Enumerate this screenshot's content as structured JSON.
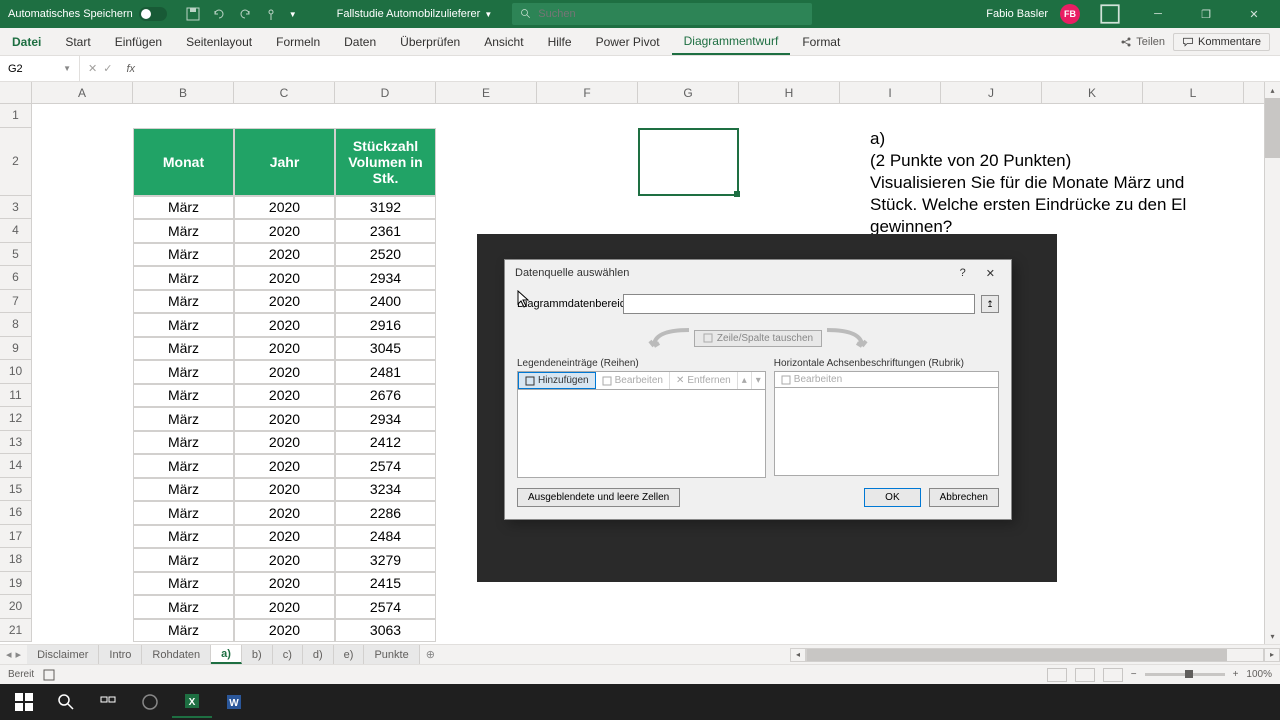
{
  "titlebar": {
    "autosave": "Automatisches Speichern",
    "filename": "Fallstudie Automobilzulieferer",
    "search_placeholder": "Suchen",
    "user_name": "Fabio Basler",
    "user_initials": "FB"
  },
  "ribbon": {
    "tabs": [
      "Datei",
      "Start",
      "Einfügen",
      "Seitenlayout",
      "Formeln",
      "Daten",
      "Überprüfen",
      "Ansicht",
      "Hilfe",
      "Power Pivot",
      "Diagrammentwurf",
      "Format"
    ],
    "active_tab": "Diagrammentwurf",
    "share": "Teilen",
    "comments": "Kommentare"
  },
  "formula_bar": {
    "name_box": "G2",
    "formula": ""
  },
  "columns": [
    "A",
    "B",
    "C",
    "D",
    "E",
    "F",
    "G",
    "H",
    "I",
    "J",
    "K",
    "L"
  ],
  "rows": [
    1,
    2,
    3,
    4,
    5,
    6,
    7,
    8,
    9,
    10,
    11,
    12,
    13,
    14,
    15,
    16,
    17,
    18,
    19,
    20,
    21
  ],
  "table": {
    "headers": [
      "Monat",
      "Jahr",
      "Stückzahl Volumen in Stk."
    ],
    "data": [
      [
        "März",
        "2020",
        "3192"
      ],
      [
        "März",
        "2020",
        "2361"
      ],
      [
        "März",
        "2020",
        "2520"
      ],
      [
        "März",
        "2020",
        "2934"
      ],
      [
        "März",
        "2020",
        "2400"
      ],
      [
        "März",
        "2020",
        "2916"
      ],
      [
        "März",
        "2020",
        "3045"
      ],
      [
        "März",
        "2020",
        "2481"
      ],
      [
        "März",
        "2020",
        "2676"
      ],
      [
        "März",
        "2020",
        "2934"
      ],
      [
        "März",
        "2020",
        "2412"
      ],
      [
        "März",
        "2020",
        "2574"
      ],
      [
        "März",
        "2020",
        "3234"
      ],
      [
        "März",
        "2020",
        "2286"
      ],
      [
        "März",
        "2020",
        "2484"
      ],
      [
        "März",
        "2020",
        "3279"
      ],
      [
        "März",
        "2020",
        "2415"
      ],
      [
        "März",
        "2020",
        "2574"
      ],
      [
        "März",
        "2020",
        "3063"
      ]
    ]
  },
  "question": {
    "label": "a)",
    "text": "(2 Punkte von 20 Punkten)\nVisualisieren Sie für die Monate März und\nStück. Welche ersten Eindrücke zu den El\ngewinnen?"
  },
  "dialog": {
    "title": "Datenquelle auswählen",
    "range_label": "Diagrammdatenbereich:",
    "swap_label": "Zeile/Spalte tauschen",
    "legend_label": "Legendeneinträge (Reihen)",
    "axis_label": "Horizontale Achsenbeschriftungen (Rubrik)",
    "btn_add": "Hinzufügen",
    "btn_edit": "Bearbeiten",
    "btn_remove": "Entfernen",
    "btn_hidden": "Ausgeblendete und leere Zellen",
    "btn_ok": "OK",
    "btn_cancel": "Abbrechen"
  },
  "sheets": {
    "tabs": [
      "Disclaimer",
      "Intro",
      "Rohdaten",
      "a)",
      "b)",
      "c)",
      "d)",
      "e)",
      "Punkte"
    ],
    "active": "a)"
  },
  "status": {
    "ready": "Bereit",
    "zoom": "100%"
  }
}
